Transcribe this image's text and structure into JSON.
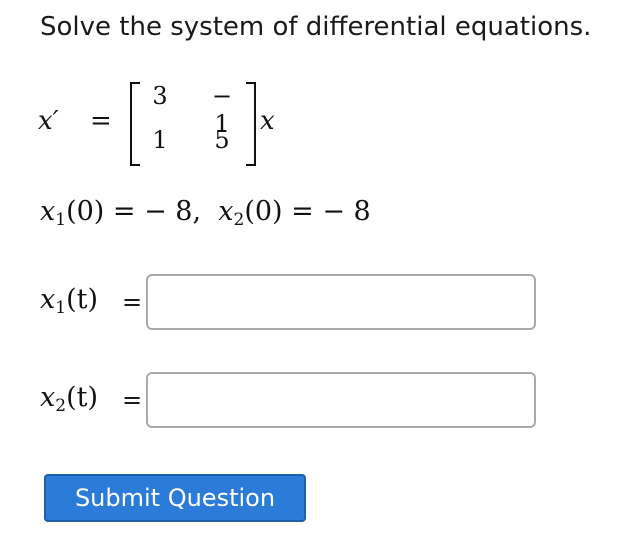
{
  "prompt": "Solve the system of differential equations.",
  "equation": {
    "lhs": "x′",
    "equals": "=",
    "matrix": {
      "row1": [
        "3",
        "− 1"
      ],
      "row2": [
        "1",
        "5"
      ]
    },
    "rhs_var": "x"
  },
  "initial_conditions": {
    "x1_var": "x",
    "x1_sub": "1",
    "x1_arg": "(0)",
    "x1_eq": " = − 8,",
    "x2_var": "x",
    "x2_sub": "2",
    "x2_arg": "(0)",
    "x2_eq": " = − 8"
  },
  "answers": [
    {
      "var": "x",
      "sub": "1",
      "arg": "(t)",
      "eq": "=",
      "value": ""
    },
    {
      "var": "x",
      "sub": "2",
      "arg": "(t)",
      "eq": "=",
      "value": ""
    }
  ],
  "submit_label": "Submit Question"
}
